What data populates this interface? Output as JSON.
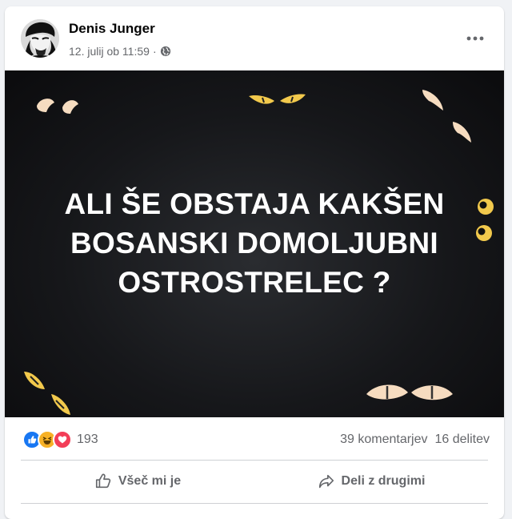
{
  "post": {
    "author": "Denis Junger",
    "date": "12. julij ob 11:59",
    "separator": "·",
    "privacy_icon": "globe-icon",
    "image_text": "ALI ŠE OBSTAJA KAKŠEN BOSANSKI DOMOLJUBNI OSTROSTRELEC ?"
  },
  "stats": {
    "reactions": [
      "like-reaction-icon",
      "haha-reaction-icon",
      "love-reaction-icon"
    ],
    "reaction_count": "193",
    "comments": "39 komentarjev",
    "shares": "16 delitev"
  },
  "actions": {
    "like_label": "Všeč mi je",
    "share_label": "Deli z drugimi"
  },
  "colors": {
    "like_blue": "#1877f2",
    "haha_yellow": "#f7b125",
    "love_red": "#f33e58",
    "secondary_text": "#65676b",
    "eye_yellow": "#f2c94c",
    "eye_cream": "#f6dcc0"
  }
}
